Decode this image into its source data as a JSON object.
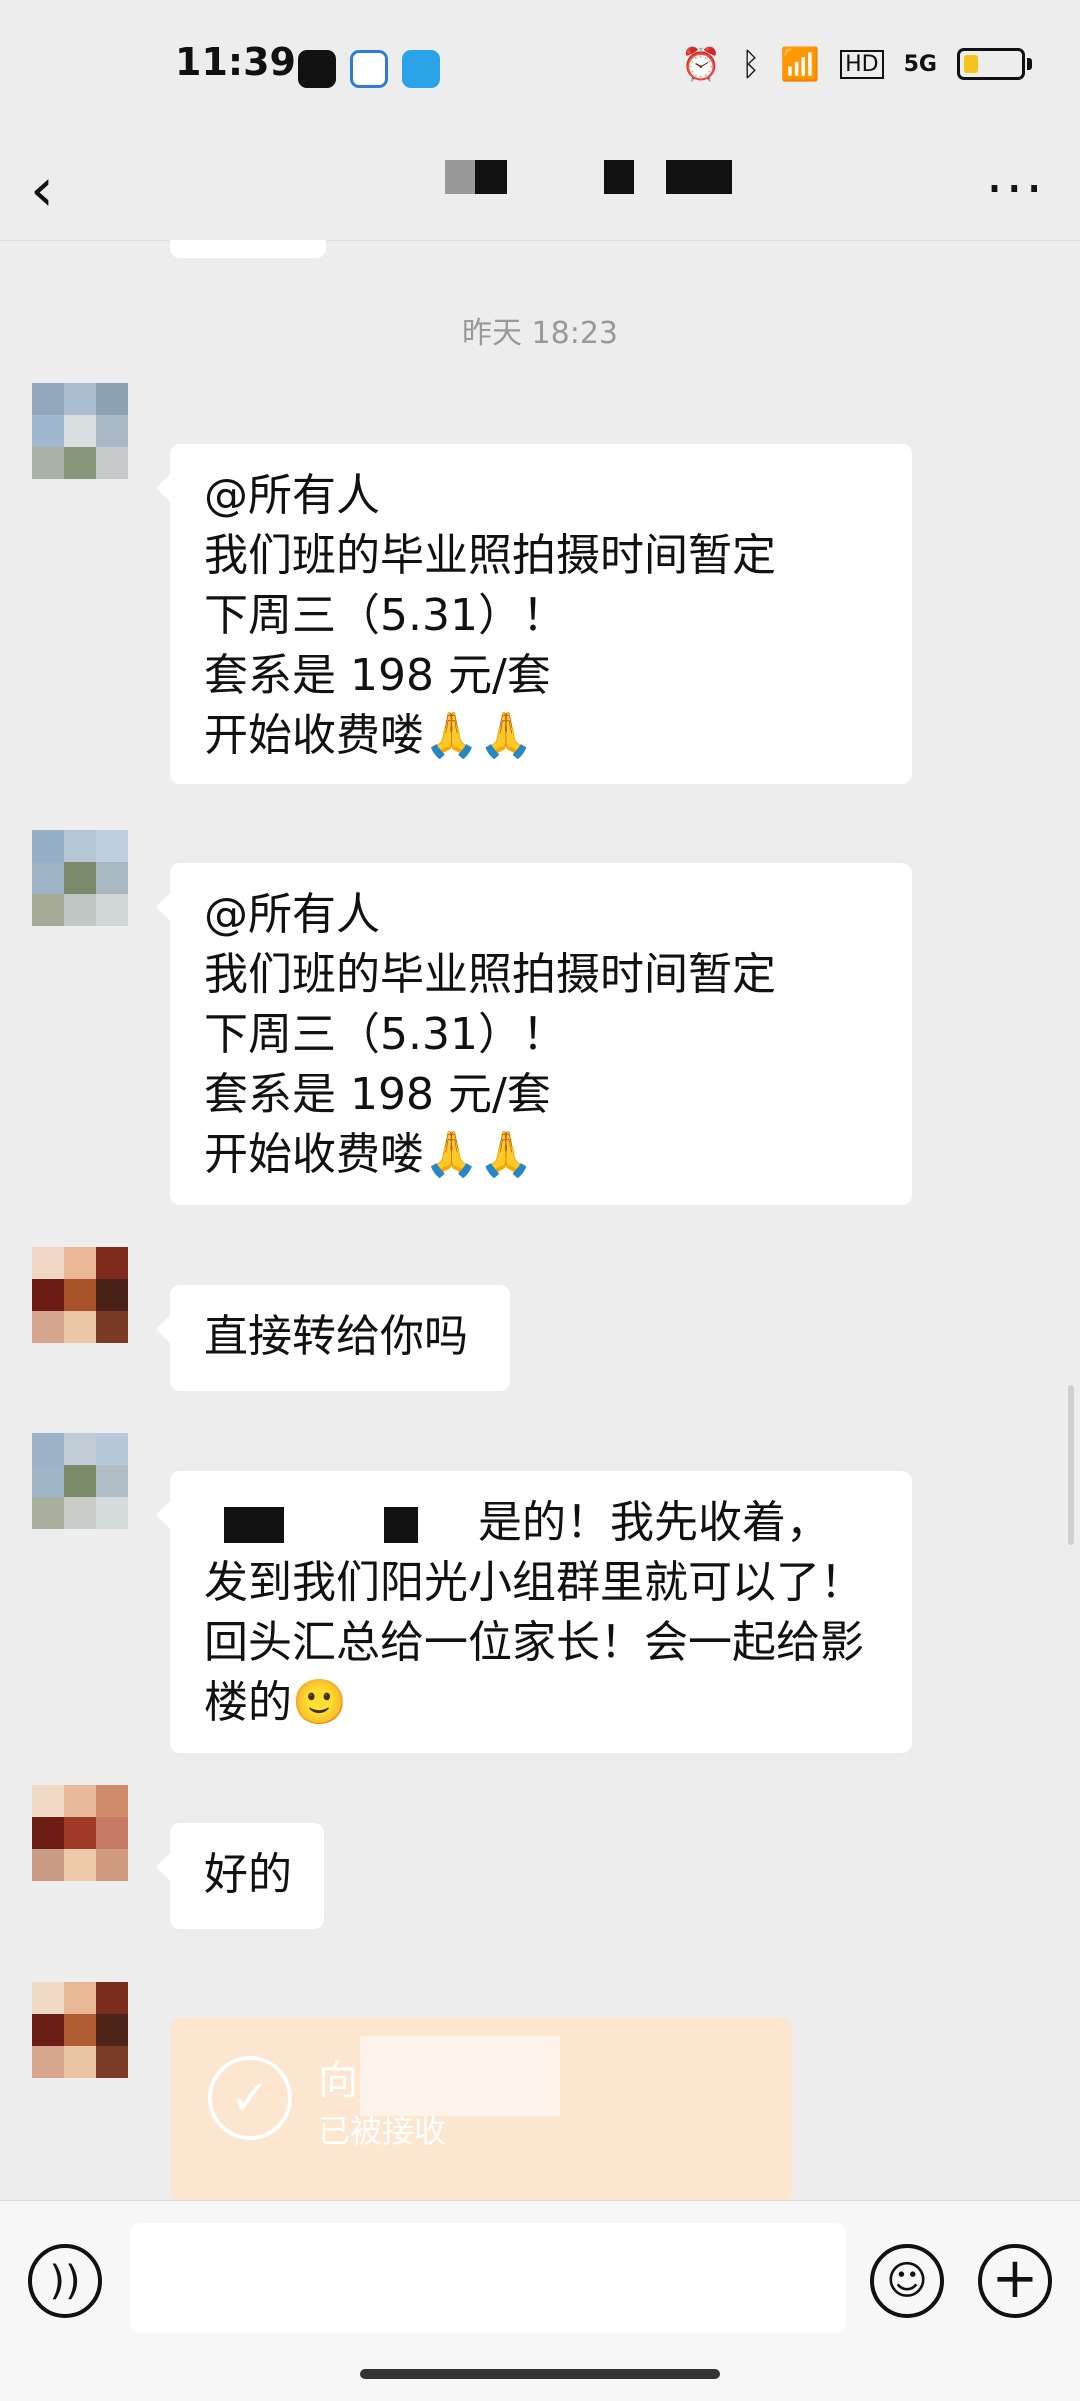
{
  "status_bar": {
    "time": "11:39",
    "network": "5G",
    "hd_badge": "HD"
  },
  "header": {
    "back_icon": "chevron-left-icon",
    "more_icon": "more-dots-icon"
  },
  "chat": {
    "timestamp": "昨天 18:23",
    "messages": [
      {
        "lines": [
          "@所有人",
          "我们班的毕业照拍摄时间暂定",
          "下周三（5.31）！",
          "套系是 198 元/套",
          "开始收费喽🙏🙏"
        ]
      },
      {
        "lines": [
          "@所有人",
          "我们班的毕业照拍摄时间暂定",
          "下周三（5.31）！",
          "套系是 198 元/套",
          "开始收费喽🙏🙏"
        ]
      },
      {
        "text": "直接转给你吗"
      },
      {
        "lines": [
          "是的！我先收着，",
          "发到我们阳光小组群里就可以了！",
          "回头汇总给一位家长！会一起给影",
          "楼的🙂"
        ]
      },
      {
        "text": "好的"
      }
    ],
    "transfer": {
      "title": "向...转账",
      "subtitle": "已被接收"
    }
  },
  "input_bar": {
    "placeholder": ""
  },
  "colors": {
    "background": "#ededed",
    "bubble": "#ffffff",
    "transfer_bg": "#fde6cf"
  }
}
